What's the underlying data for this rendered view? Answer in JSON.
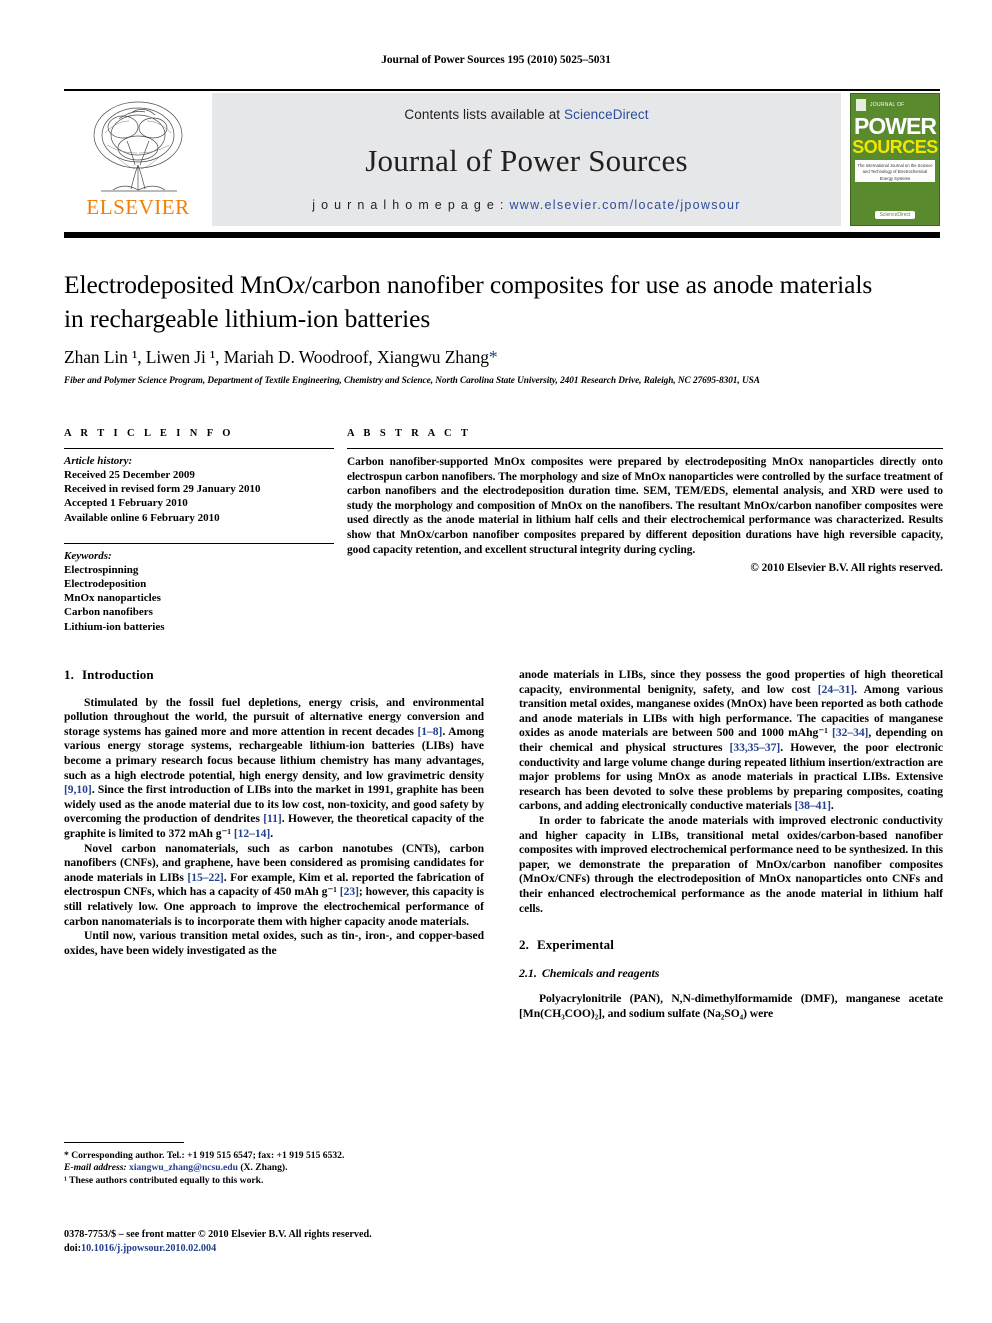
{
  "running_head": "Journal of Power Sources 195 (2010) 5025–5031",
  "masthead": {
    "publisher_name": "ELSEVIER",
    "contents_prefix": "Contents lists available at ",
    "contents_link": "ScienceDirect",
    "journal_name": "Journal of Power Sources",
    "homepage_label": "j o u r n a l   h o m e p a g e :   ",
    "homepage_url": "www.elsevier.com/locate/jpowsour",
    "cover": {
      "journal_of": "JOURNAL OF",
      "power": "POWER",
      "sources": "SOURCES",
      "tagline": "The International Journal on the Science and Technology of Electrochemical Energy Systems",
      "badge": "ScienceDirect"
    }
  },
  "article": {
    "title_line1_a": "Electrodeposited MnO",
    "title_line1_x": "x",
    "title_line1_b": "/carbon nanofiber composites for use as anode materials",
    "title_line2": "in rechargeable lithium-ion batteries",
    "authors": "Zhan Lin ¹, Liwen Ji ¹, Mariah D. Woodroof, Xiangwu Zhang",
    "authors_star": "*",
    "affiliation": "Fiber and Polymer Science Program, Department of Textile Engineering, Chemistry and Science, North Carolina State University, 2401 Research Drive, Raleigh, NC 27695-8301, USA"
  },
  "article_info": {
    "heading": "A R T I C L E   I N F O",
    "history_label": "Article history:",
    "history": [
      "Received 25 December 2009",
      "Received in revised form 29 January 2010",
      "Accepted 1 February 2010",
      "Available online 6 February 2010"
    ],
    "keywords_label": "Keywords:",
    "keywords": [
      "Electrospinning",
      "Electrodeposition",
      "MnOx nanoparticles",
      "Carbon nanofibers",
      "Lithium-ion batteries"
    ]
  },
  "abstract": {
    "heading": "A B S T R A C T",
    "text": "Carbon nanofiber-supported MnOx composites were prepared by electrodepositing MnOx nanoparticles directly onto electrospun carbon nanofibers. The morphology and size of MnOx nanoparticles were controlled by the surface treatment of carbon nanofibers and the electrodeposition duration time. SEM, TEM/EDS, elemental analysis, and XRD were used to study the morphology and composition of MnOx on the nanofibers. The resultant MnOx/carbon nanofiber composites were used directly as the anode material in lithium half cells and their electrochemical performance was characterized. Results show that MnOx/carbon nanofiber composites prepared by different deposition durations have high reversible capacity, good capacity retention, and excellent structural integrity during cycling.",
    "copyright": "© 2010 Elsevier B.V. All rights reserved."
  },
  "sections": {
    "intro_num": "1.",
    "intro_title": "Introduction",
    "experimental_num": "2.",
    "experimental_title": "Experimental",
    "chemicals_num": "2.1.",
    "chemicals_title": "Chemicals and reagents"
  },
  "body": {
    "left_p1_a": "Stimulated by the fossil fuel depletions, energy crisis, and environmental pollution throughout the world, the pursuit of alternative energy conversion and storage systems has gained more and more attention in recent decades ",
    "left_p1_r1": "[1–8]",
    "left_p1_b": ". Among various energy storage systems, rechargeable lithium-ion batteries (LIBs) have become a primary research focus because lithium chemistry has many advantages, such as a high electrode potential, high energy density, and low gravimetric density ",
    "left_p1_r2": "[9,10]",
    "left_p1_c": ". Since the first introduction of LIBs into the market in 1991, graphite has been widely used as the anode material due to its low cost, non-toxicity, and good safety by overcoming the production of dendrites ",
    "left_p1_r3": "[11]",
    "left_p1_d": ". However, the theoretical capacity of the graphite is limited to 372 mAh g⁻¹ ",
    "left_p1_r4": "[12–14]",
    "left_p1_e": ".",
    "left_p2_a": "Novel carbon nanomaterials, such as carbon nanotubes (CNTs), carbon nanofibers (CNFs), and graphene, have been considered as promising candidates for anode materials in LIBs ",
    "left_p2_r1": "[15–22]",
    "left_p2_b": ". For example, Kim et al. reported the fabrication of electrospun CNFs, which has a capacity of 450 mAh g⁻¹ ",
    "left_p2_r2": "[23]",
    "left_p2_c": "; however, this capacity is still relatively low. One approach to improve the electrochemical performance of carbon nanomaterials is to incorporate them with higher capacity anode materials.",
    "left_p3": "Until now, various transition metal oxides, such as tin-, iron-, and copper-based oxides, have been widely investigated as the",
    "right_p1_a": "anode materials in LIBs, since they possess the good properties of high theoretical capacity, environmental benignity, safety, and low cost ",
    "right_p1_r1": "[24–31]",
    "right_p1_b": ". Among various transition metal oxides, manganese oxides (MnOx) have been reported as both cathode and anode materials in LIBs with high performance. The capacities of manganese oxides as anode materials are between 500 and 1000 mAhg⁻¹ ",
    "right_p1_r2": "[32–34]",
    "right_p1_c": ", depending on their chemical and physical structures ",
    "right_p1_r3": "[33,35–37]",
    "right_p1_d": ". However, the poor electronic conductivity and large volume change during repeated lithium insertion/extraction are major problems for using MnOx as anode materials in practical LIBs. Extensive research has been devoted to solve these problems by preparing composites, coating carbons, and adding electronically conductive materials ",
    "right_p1_r4": "[38–41]",
    "right_p1_e": ".",
    "right_p2": "In order to fabricate the anode materials with improved electronic conductivity and higher capacity in LIBs, transitional metal oxides/carbon-based nanofiber composites with improved electrochemical performance need to be synthesized. In this paper, we demonstrate the preparation of MnOx/carbon nanofiber composites (MnOx/CNFs) through the electrodeposition of MnOx nanoparticles onto CNFs and their enhanced electrochemical performance as the anode material in lithium half cells.",
    "right_p3": "Polyacrylonitrile (PAN), N,N-dimethylformamide (DMF), manganese acetate [Mn(CH₃COO)₂], and sodium sulfate (Na₂SO₄) were"
  },
  "footnotes": {
    "corresponding": "* Corresponding author. Tel.: +1 919 515 6547; fax: +1 919 515 6532.",
    "email_label": "E-mail address:",
    "email": "xiangwu_zhang@ncsu.edu",
    "email_suffix": " (X. Zhang).",
    "equal_contrib": "¹ These authors contributed equally to this work."
  },
  "imprint": {
    "line1": "0378-7753/$ – see front matter © 2010 Elsevier B.V. All rights reserved.",
    "doi_prefix": "doi:",
    "doi": "10.1016/j.jpowsour.2010.02.004"
  },
  "colors": {
    "link": "#23408e",
    "sciencedirect": "#2c4c9c",
    "elsevier_orange": "#F07F09",
    "band_gray": "#e6e7e8",
    "cover_green": "#5a8a2e"
  }
}
